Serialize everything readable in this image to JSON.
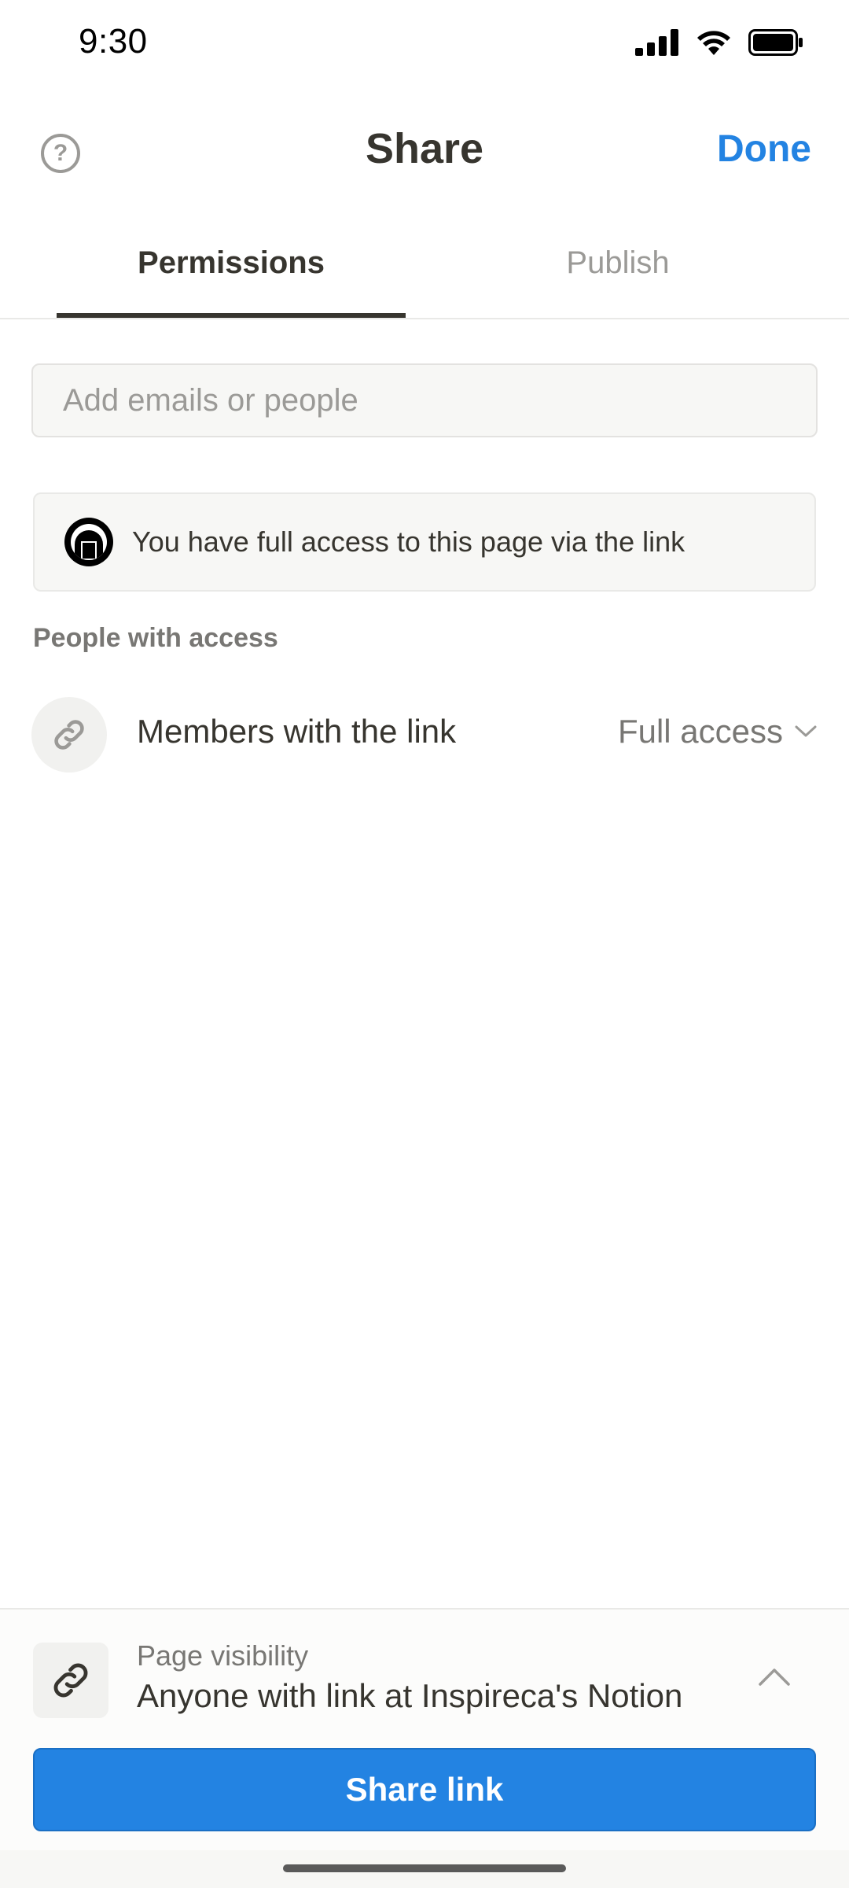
{
  "status_bar": {
    "time": "9:30"
  },
  "header": {
    "title": "Share",
    "done_label": "Done",
    "help_glyph": "?"
  },
  "tabs": [
    {
      "label": "Permissions",
      "active": true
    },
    {
      "label": "Publish",
      "active": false
    }
  ],
  "email_input": {
    "placeholder": "Add emails or people",
    "value": ""
  },
  "info_notice": {
    "text": "You have full access to this page via  the link"
  },
  "people_section": {
    "label": "People with access",
    "rows": [
      {
        "label": "Members with the link",
        "access": "Full access",
        "icon": "link-icon"
      }
    ]
  },
  "page_visibility": {
    "title": "Page visibility",
    "value": "Anyone with link at Inspireca's Notion",
    "icon": "link-icon"
  },
  "share_button": {
    "label": "Share link"
  },
  "colors": {
    "accent": "#2383e2",
    "text": "#37352f",
    "muted": "#787774"
  }
}
